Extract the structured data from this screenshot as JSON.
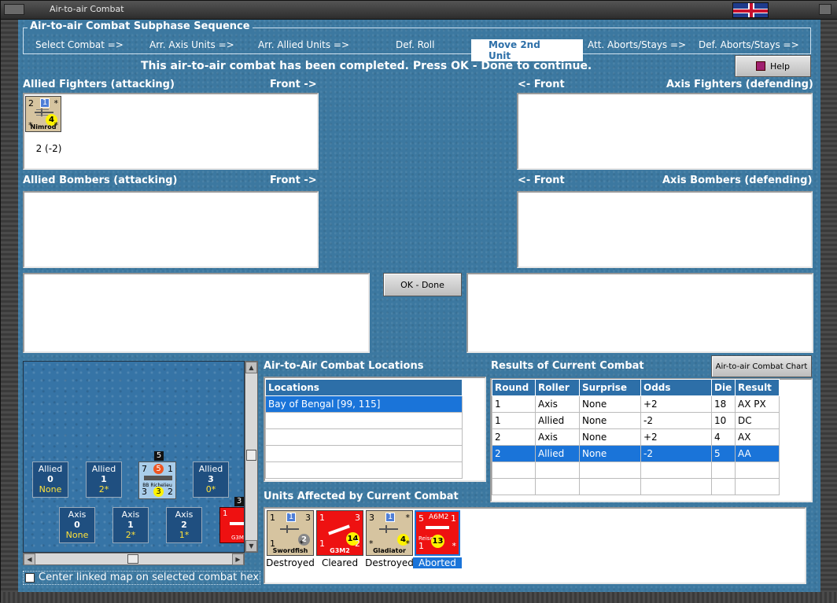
{
  "window": {
    "title": "Air-to-air Combat"
  },
  "phase": {
    "title": "Air-to-air Combat Subphase Sequence",
    "steps": [
      "Select Combat =>",
      "Arr. Axis Units =>",
      "Arr. Allied Units =>",
      "Def. Roll",
      "Move 2nd Unit",
      "Att. Aborts/Stays =>",
      "Def. Aborts/Stays =>"
    ],
    "active_index": 4
  },
  "message": "This air-to-air combat has been completed.  Press OK - Done to continue.",
  "help_label": "Help",
  "sections": {
    "allied_fighters": "Allied Fighters (attacking)",
    "allied_bombers": "Allied Bombers (attacking)",
    "axis_fighters": "Axis Fighters (defending)",
    "axis_bombers": "Axis Bombers (defending)",
    "front_right": "Front ->",
    "front_left": "<- Front"
  },
  "allied_fighter_unit": {
    "name": "Nimrod",
    "tl": "2",
    "blue": "1",
    "tr": "*",
    "bl": "*",
    "br": "*",
    "circle": "4",
    "caption": "2 (-2)"
  },
  "ok_label": "OK - Done",
  "map": {
    "allied_boxes": [
      {
        "title": "Allied",
        "num": "0",
        "sub": "None"
      },
      {
        "title": "Allied",
        "num": "1",
        "sub": "2*"
      },
      {
        "title": "Allied",
        "num": "3",
        "sub": "0*"
      }
    ],
    "axis_boxes": [
      {
        "title": "Axis",
        "num": "0",
        "sub": "None"
      },
      {
        "title": "Axis",
        "num": "1",
        "sub": "2*"
      },
      {
        "title": "Axis",
        "num": "2",
        "sub": "1*"
      }
    ],
    "ship": {
      "name": "BB Richelieu",
      "tl": "7",
      "circle": "5",
      "tr": "1",
      "bl": "3",
      "circle2": "3",
      "br": "2",
      "badge": "5"
    },
    "edge_badge": "3",
    "edge_counter": {
      "tl": "1",
      "br": "G3M"
    }
  },
  "center_checkbox_label": "Center linked map on selected combat hex",
  "locations": {
    "title": "Air-to-Air Combat Locations",
    "header": "Locations",
    "rows": [
      "Bay of Bengal [99, 115]",
      "",
      "",
      "",
      "",
      ""
    ]
  },
  "results": {
    "title": "Results of Current Combat",
    "chart_button": "Air-to-air Combat Chart",
    "headers": [
      "Round",
      "Roller",
      "Surprise",
      "Odds",
      "Die",
      "Result"
    ],
    "rows": [
      [
        "1",
        "Axis",
        "None",
        "+2",
        "18",
        "AX PX"
      ],
      [
        "1",
        "Allied",
        "None",
        "-2",
        "10",
        "DC"
      ],
      [
        "2",
        "Axis",
        "None",
        "+2",
        "4",
        "AX"
      ],
      [
        "2",
        "Allied",
        "None",
        "-2",
        "5",
        "AA"
      ],
      [
        "",
        "",
        "",
        "",
        "",
        ""
      ],
      [
        "",
        "",
        "",
        "",
        "",
        ""
      ]
    ],
    "selected_row": 3
  },
  "affected": {
    "title": "Units Affected by Current Combat",
    "units": [
      {
        "name": "Swordfish",
        "tl": "1",
        "blue": "1",
        "tr": "3",
        "bl": "1",
        "br": "*",
        "circle": "2",
        "status": "Destroyed",
        "color": "tan",
        "circle_color": "grey"
      },
      {
        "name": "G3M2",
        "tl": "1",
        "blue": "",
        "tr": "3",
        "bl": "1",
        "br": "2",
        "circle": "14",
        "status": "Cleared",
        "color": "red",
        "circle_color": "yellow"
      },
      {
        "name": "Gladiator",
        "tl": "3",
        "blue": "1",
        "tr": "*",
        "bl": "*",
        "br": "*",
        "circle": "4",
        "status": "Destroyed",
        "color": "tan",
        "circle_color": "yellow"
      },
      {
        "name": "A6M2",
        "tl": "5",
        "blue": "",
        "tr": "1",
        "bl": "1",
        "br": "*",
        "circle": "13",
        "status": "Aborted",
        "color": "red",
        "circle_color": "yellow",
        "sub": "Reisen"
      }
    ],
    "selected_index": 3
  },
  "colors": {
    "ocean": "#3c78a0",
    "header_blue": "#2d6fa8",
    "selection": "#1a74d9",
    "counter_red": "#ee1111",
    "counter_tan": "#d6c4a0"
  }
}
